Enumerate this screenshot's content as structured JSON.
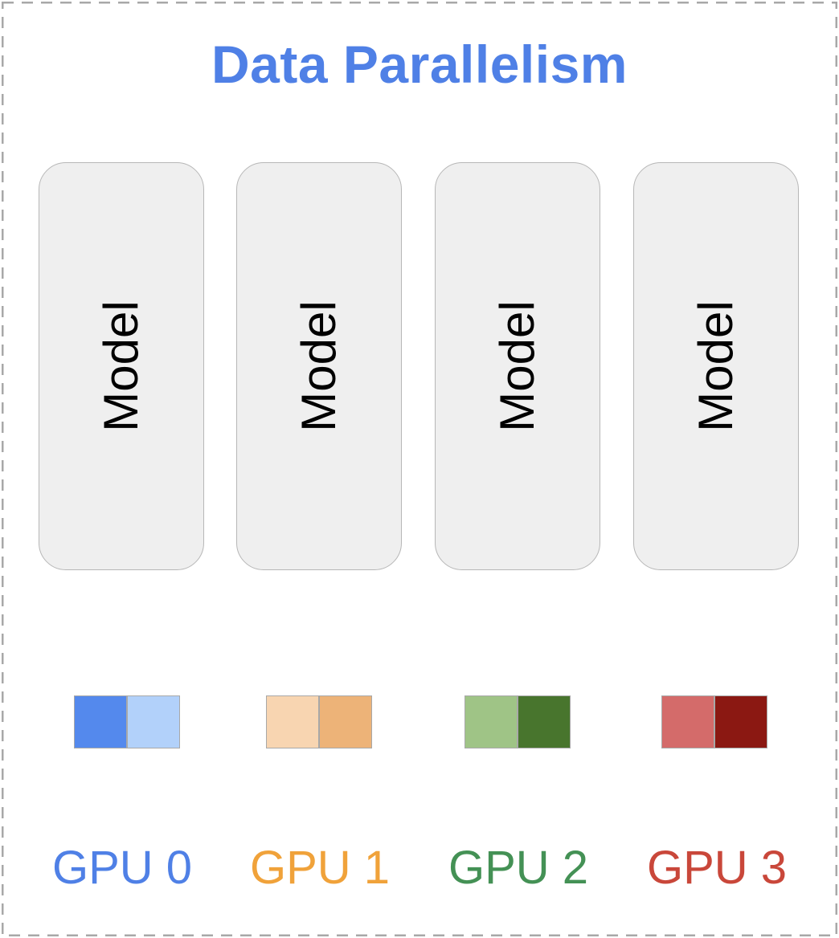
{
  "title": {
    "text": "Data Parallelism",
    "color": "#4f80e6"
  },
  "frame": {
    "border_color": "#a8a8a8",
    "style": "dashed"
  },
  "gpus": [
    {
      "label": "GPU 0",
      "label_color": "#4f80e6",
      "model_label": "Model",
      "shard_colors": [
        "#5489ed",
        "#b2d1fa"
      ]
    },
    {
      "label": "GPU 1",
      "label_color": "#f0a23a",
      "model_label": "Model",
      "shard_colors": [
        "#f8d5b1",
        "#edb378"
      ]
    },
    {
      "label": "GPU 2",
      "label_color": "#449155",
      "model_label": "Model",
      "shard_colors": [
        "#9fc486",
        "#48752d"
      ]
    },
    {
      "label": "GPU 3",
      "label_color": "#c9473a",
      "model_label": "Model",
      "shard_colors": [
        "#d46b6a",
        "#8b1812"
      ]
    }
  ]
}
